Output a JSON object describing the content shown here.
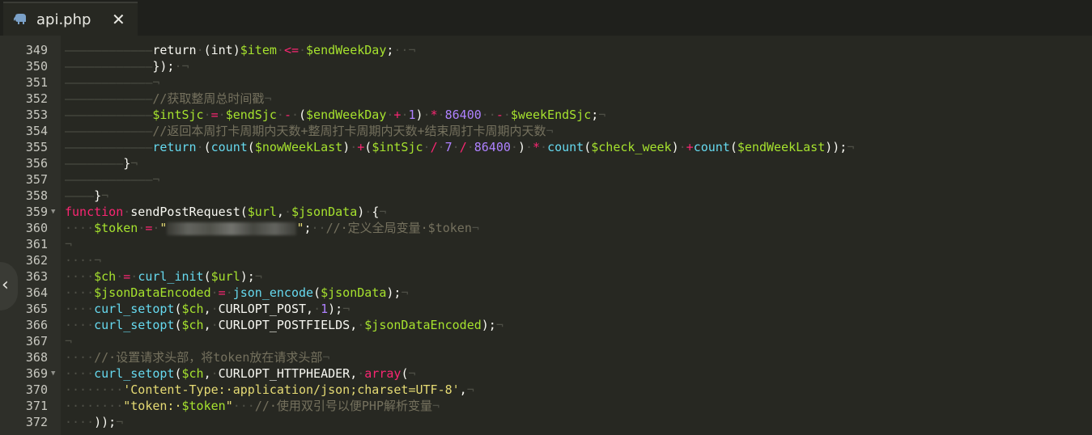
{
  "tab": {
    "title": "api.php",
    "close_glyph": "✕",
    "icon": "php-elephant-icon"
  },
  "sidebar_toggle": {
    "icon": "chevron-left-icon",
    "glyph": "‹"
  },
  "lines": [
    {
      "num": "349",
      "html": "<span class=\"ws\">————————————</span>return<span class=\"ws\">·</span>(int)<span class=\"v\">$item</span><span class=\"ws\">·</span><span class=\"k\">&lt;=</span><span class=\"ws\">·</span><span class=\"v\">$endWeekDay</span>;<span class=\"ws\">··¬</span>"
    },
    {
      "num": "350",
      "html": "<span class=\"ws\">————————————</span>});<span class=\"ws\">·¬</span>"
    },
    {
      "num": "351",
      "html": "<span class=\"ws\">————————————¬</span>"
    },
    {
      "num": "352",
      "html": "<span class=\"ws\">————————————</span><span class=\"c\">//获取整周总时间戳</span><span class=\"ws\">¬</span>"
    },
    {
      "num": "353",
      "html": "<span class=\"ws\">————————————</span><span class=\"v\">$intSjc</span><span class=\"ws\">·</span><span class=\"k\">=</span><span class=\"ws\">·</span><span class=\"v\">$endSjc</span><span class=\"ws\">·</span><span class=\"k\">-</span><span class=\"ws\">·</span>(<span class=\"v\">$endWeekDay</span><span class=\"ws\">·</span><span class=\"k\">+</span><span class=\"ws\">·</span><span class=\"n\">1</span>)<span class=\"ws\">·</span><span class=\"k\">*</span><span class=\"ws\">·</span><span class=\"n\">86400</span><span class=\"ws\">··</span><span class=\"k\">-</span><span class=\"ws\">·</span><span class=\"v\">$weekEndSjc</span>;<span class=\"ws\">¬</span>"
    },
    {
      "num": "354",
      "html": "<span class=\"ws\">————————————</span><span class=\"c\">//返回本周打卡周期内天数+整周打卡周期内天数+结束周打卡周期内天数</span><span class=\"ws\">¬</span>"
    },
    {
      "num": "355",
      "html": "<span class=\"ws\">————————————</span><span class=\"f\">return</span><span class=\"ws\">·</span>(<span class=\"f\">count</span>(<span class=\"v\">$nowWeekLast</span>)<span class=\"ws\">·</span><span class=\"k\">+</span>(<span class=\"v\">$intSjc</span><span class=\"ws\">·</span><span class=\"k\">/</span><span class=\"ws\">·</span><span class=\"n\">7</span><span class=\"ws\">·</span><span class=\"k\">/</span><span class=\"ws\">·</span><span class=\"n\">86400</span><span class=\"ws\">·</span>)<span class=\"ws\">·</span><span class=\"k\">*</span><span class=\"ws\">·</span><span class=\"f\">count</span>(<span class=\"v\">$check_week</span>)<span class=\"ws\">·</span><span class=\"k\">+</span><span class=\"f\">count</span>(<span class=\"v\">$endWeekLast</span>));<span class=\"ws\">¬</span>"
    },
    {
      "num": "356",
      "html": "<span class=\"ws\">————————</span>}<span class=\"ws\">¬</span>"
    },
    {
      "num": "357",
      "html": "<span class=\"ws\">————————————¬</span>"
    },
    {
      "num": "358",
      "html": "<span class=\"ws\">————</span>}<span class=\"ws\">¬</span>"
    },
    {
      "num": "359",
      "html": "<span class=\"k\">function</span><span class=\"ws\">·</span>sendPostRequest(<span class=\"v\">$url</span>,<span class=\"ws\">·</span><span class=\"v\">$jsonData</span>)<span class=\"ws\">·</span>{<span class=\"ws\">¬</span>"
    },
    {
      "num": "360",
      "html": "<span class=\"ws\">····</span><span class=\"v\">$token</span><span class=\"ws\">·</span><span class=\"k\">=</span><span class=\"ws\">·</span><span class=\"s\">\"</span><span class=\"blur\"></span><span class=\"s\">\"</span>;<span class=\"ws\">··</span><span class=\"c\">//·定义全局变量·$token</span><span class=\"ws\">¬</span>"
    },
    {
      "num": "361",
      "html": "<span class=\"ws\">¬</span>"
    },
    {
      "num": "362",
      "html": "<span class=\"ws\">····¬</span>"
    },
    {
      "num": "363",
      "html": "<span class=\"ws\">····</span><span class=\"v\">$ch</span><span class=\"ws\">·</span><span class=\"k\">=</span><span class=\"ws\">·</span><span class=\"f\">curl_init</span>(<span class=\"v\">$url</span>);<span class=\"ws\">¬</span>"
    },
    {
      "num": "364",
      "html": "<span class=\"ws\">····</span><span class=\"v\">$jsonDataEncoded</span><span class=\"ws\">·</span><span class=\"k\">=</span><span class=\"ws\">·</span><span class=\"f\">json_encode</span>(<span class=\"v\">$jsonData</span>);<span class=\"ws\">¬</span>"
    },
    {
      "num": "365",
      "html": "<span class=\"ws\">····</span><span class=\"f\">curl_setopt</span>(<span class=\"v\">$ch</span>,<span class=\"ws\">·</span>CURLOPT_POST,<span class=\"ws\">·</span><span class=\"n\">1</span>);<span class=\"ws\">¬</span>"
    },
    {
      "num": "366",
      "html": "<span class=\"ws\">····</span><span class=\"f\">curl_setopt</span>(<span class=\"v\">$ch</span>,<span class=\"ws\">·</span>CURLOPT_POSTFIELDS,<span class=\"ws\">·</span><span class=\"v\">$jsonDataEncoded</span>);<span class=\"ws\">¬</span>"
    },
    {
      "num": "367",
      "html": "<span class=\"ws\">¬</span>"
    },
    {
      "num": "368",
      "html": "<span class=\"ws\">····</span><span class=\"c\">//·设置请求头部，将token放在请求头部</span><span class=\"ws\">¬</span>"
    },
    {
      "num": "369",
      "html": "<span class=\"ws\">····</span><span class=\"f\">curl_setopt</span>(<span class=\"v\">$ch</span>,<span class=\"ws\">·</span>CURLOPT_HTTPHEADER,<span class=\"ws\">·</span><span class=\"k\">array</span>(<span class=\"ws\">¬</span>"
    },
    {
      "num": "370",
      "html": "<span class=\"ws\">········</span><span class=\"s\">'Content-Type:·application/json;charset=UTF-8'</span>,<span class=\"ws\">¬</span>"
    },
    {
      "num": "371",
      "html": "<span class=\"ws\">········</span><span class=\"s\">\"token:·</span><span class=\"v\">$token</span><span class=\"s\">\"</span><span class=\"ws\">···</span><span class=\"c\">//·使用双引号以便PHP解析变量</span><span class=\"ws\">¬</span>"
    },
    {
      "num": "372",
      "html": "<span class=\"ws\">····</span>));<span class=\"ws\">¬</span>"
    }
  ],
  "fold_markers": [
    "359",
    "369"
  ]
}
